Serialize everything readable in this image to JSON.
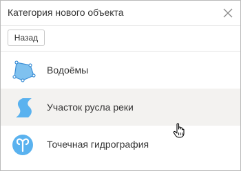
{
  "dialog": {
    "title": "Категория нового объекта",
    "close_icon": "close-icon"
  },
  "toolbar": {
    "back_label": "Назад"
  },
  "categories": [
    {
      "label": "Водоёмы",
      "icon": "polygon-icon",
      "icon_color": "#6fb7ea",
      "state": "normal"
    },
    {
      "label": "Участок русла реки",
      "icon": "river-segment-icon",
      "icon_color": "#5ab2ef",
      "state": "hover"
    },
    {
      "label": "Точечная гидрография",
      "icon": "spring-icon",
      "icon_color": "#5ab2ef",
      "state": "normal"
    }
  ],
  "cursor": "hand-pointer-icon",
  "colors": {
    "hover_background": "#f3f2f0",
    "border": "#b9b9b9",
    "divider": "#e3e3e3",
    "text": "#333333"
  }
}
